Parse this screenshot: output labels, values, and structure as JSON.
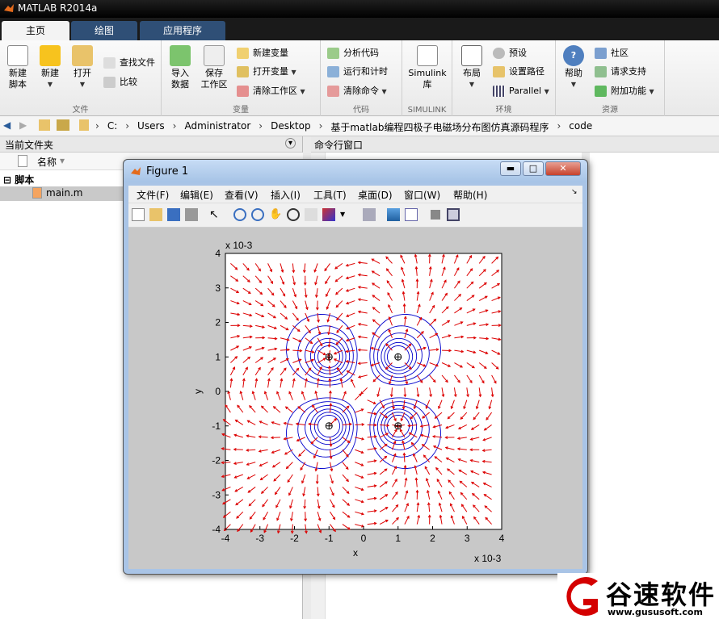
{
  "window": {
    "title": "MATLAB R2014a"
  },
  "tabs": [
    "主页",
    "绘图",
    "应用程序"
  ],
  "ribbon": {
    "file": {
      "label": "文件",
      "new_script": "新建\n脚本",
      "new": "新建",
      "open": "打开",
      "find_files": "查找文件",
      "compare": "比较"
    },
    "variable": {
      "label": "变量",
      "import": "导入\n数据",
      "save_ws": "保存\n工作区",
      "new_var": "新建变量",
      "open_var": "打开变量",
      "clear_ws": "清除工作区"
    },
    "code": {
      "label": "代码",
      "analyze": "分析代码",
      "run_time": "运行和计时",
      "clear_cmd": "清除命令"
    },
    "simulink": {
      "label": "SIMULINK",
      "library": "Simulink\n库"
    },
    "env": {
      "label": "环境",
      "layout": "布局",
      "prefs": "预设",
      "set_path": "设置路径",
      "parallel": "Parallel"
    },
    "resources": {
      "label": "资源",
      "help": "帮助",
      "community": "社区",
      "support": "请求支持",
      "addons": "附加功能"
    }
  },
  "address": {
    "path": [
      "C:",
      "Users",
      "Administrator",
      "Desktop",
      "基于matlab编程四极子电磁场分布图仿真源码程序",
      "code"
    ]
  },
  "left_panel": {
    "title": "当前文件夹",
    "col_name": "名称",
    "folder": "脚本",
    "file": "main.m"
  },
  "cmd_panel": {
    "title": "命令行窗口"
  },
  "figure": {
    "title": "Figure 1",
    "menu": [
      "文件(F)",
      "编辑(E)",
      "查看(V)",
      "插入(I)",
      "工具(T)",
      "桌面(D)",
      "窗口(W)",
      "帮助(H)"
    ]
  },
  "chart_data": {
    "type": "scatter",
    "title": "",
    "xlabel": "x",
    "ylabel": "y",
    "x_multiplier": "x 10-3",
    "y_multiplier": "x 10-3",
    "xlim": [
      -4,
      4
    ],
    "ylim": [
      -4,
      4
    ],
    "xticks": [
      -4,
      -3,
      -2,
      -1,
      0,
      1,
      2,
      3,
      4
    ],
    "yticks": [
      -4,
      -3,
      -2,
      -1,
      0,
      1,
      2,
      3,
      4
    ],
    "charges": [
      {
        "x": -1,
        "y": 1,
        "sign": "negative"
      },
      {
        "x": 1,
        "y": 1,
        "sign": "positive"
      },
      {
        "x": -1,
        "y": -1,
        "sign": "positive"
      },
      {
        "x": 1,
        "y": -1,
        "sign": "negative"
      }
    ],
    "contour_color": "#0000cc",
    "arrow_color": "#dd0000"
  },
  "watermark": {
    "brand": "谷速软件",
    "url": "www.gususoft.com"
  }
}
